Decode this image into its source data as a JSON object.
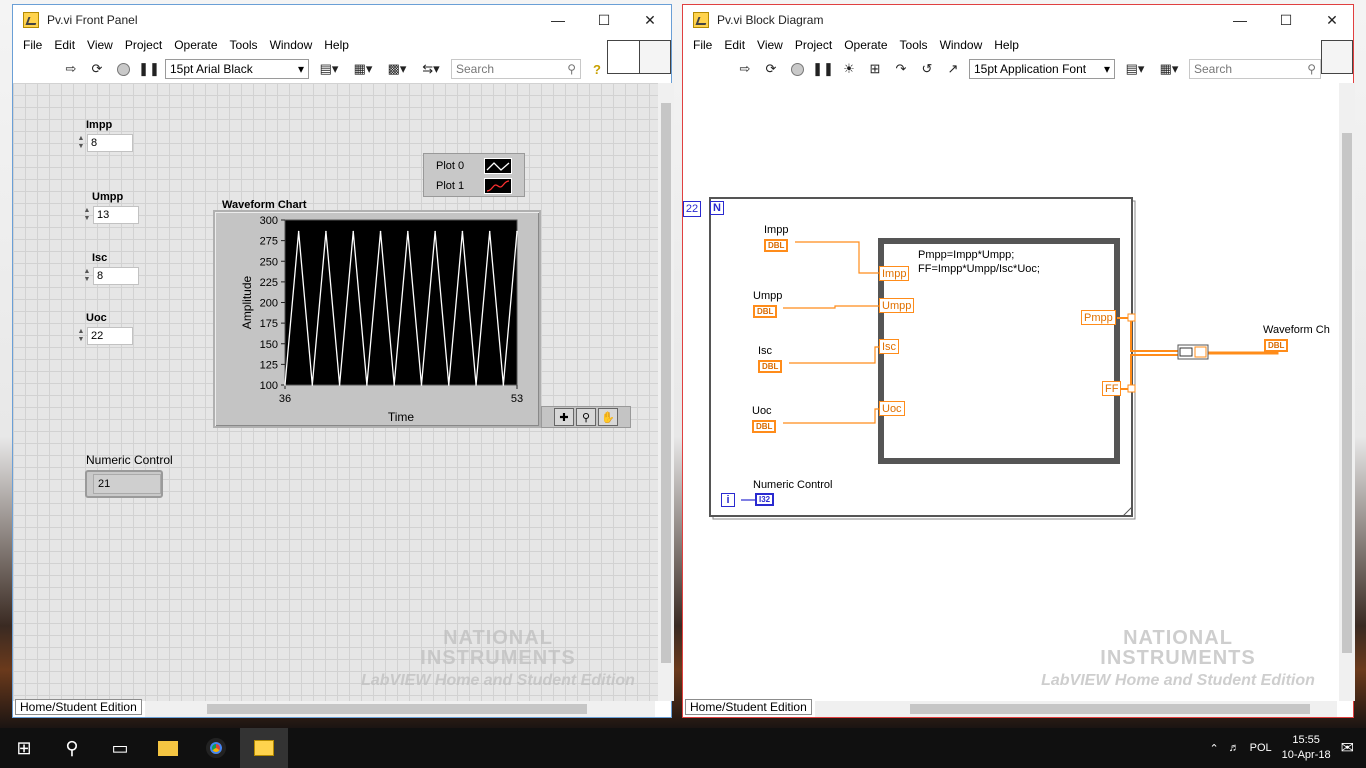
{
  "front_panel": {
    "title": "Pv.vi Front Panel",
    "menu": [
      "File",
      "Edit",
      "View",
      "Project",
      "Operate",
      "Tools",
      "Window",
      "Help"
    ],
    "font_selector": "15pt Arial Black",
    "search_placeholder": "Search",
    "controls": [
      {
        "label": "Impp",
        "value": "8"
      },
      {
        "label": "Umpp",
        "value": "13"
      },
      {
        "label": "Isc",
        "value": "8"
      },
      {
        "label": "Uoc",
        "value": "22"
      }
    ],
    "chart": {
      "title": "Waveform Chart",
      "ylabel": "Amplitude",
      "xlabel": "Time",
      "y_ticks": [
        "300",
        "275",
        "250",
        "225",
        "200",
        "175",
        "150",
        "125",
        "100"
      ],
      "x_ticks": [
        "36",
        "53"
      ],
      "legend": [
        "Plot 0",
        "Plot 1"
      ]
    },
    "indicator": {
      "label": "Numeric Control",
      "value": "21"
    },
    "status": "Home/Student Edition",
    "watermark": {
      "line1": "NATIONAL",
      "line2": "INSTRUMENTS",
      "line3": "LabVIEW Home and Student Edition"
    }
  },
  "chart_data": {
    "type": "line",
    "title": "Waveform Chart",
    "xlabel": "Time",
    "ylabel": "Amplitude",
    "x": [
      36,
      37,
      38,
      39,
      40,
      41,
      42,
      43,
      44,
      45,
      46,
      47,
      48,
      49,
      50,
      51,
      52,
      53
    ],
    "series": [
      {
        "name": "Plot 0",
        "values": [
          100,
          286,
          100,
          286,
          100,
          286,
          100,
          286,
          100,
          286,
          100,
          286,
          100,
          286,
          100,
          286,
          100,
          286
        ]
      }
    ],
    "xlim": [
      36,
      53
    ],
    "ylim": [
      100,
      300
    ],
    "grid": false,
    "legend_position": "top-right"
  },
  "block_diagram": {
    "title": "Pv.vi Block Diagram",
    "menu": [
      "File",
      "Edit",
      "View",
      "Project",
      "Operate",
      "Tools",
      "Window",
      "Help"
    ],
    "font_selector": "15pt Application Font",
    "search_placeholder": "Search",
    "loop_count": "22",
    "loop_n": "N",
    "loop_i": "i",
    "terminals": [
      {
        "label": "Impp",
        "type": "DBL"
      },
      {
        "label": "Umpp",
        "type": "DBL"
      },
      {
        "label": "Isc",
        "type": "DBL"
      },
      {
        "label": "Uoc",
        "type": "DBL"
      }
    ],
    "formula_inputs": [
      "Impp",
      "Umpp",
      "Isc",
      "Uoc"
    ],
    "formula_outputs": [
      "Pmpp",
      "FF"
    ],
    "formula_line1": "Pmpp=Impp*Umpp;",
    "formula_line2": "FF=Impp*Umpp/Isc*Uoc;",
    "numeric_control": {
      "label": "Numeric Control",
      "type": "I32"
    },
    "waveform_terminal": {
      "label": "Waveform Ch",
      "type": "DBL"
    },
    "status": "Home/Student Edition"
  },
  "taskbar": {
    "time": "15:55",
    "date": "10-Apr-18",
    "lang": "POL"
  },
  "colors": {
    "wire_orange": "#ff8c1a",
    "wire_blue": "#2a2ad0",
    "plot_bg": "#000000"
  }
}
